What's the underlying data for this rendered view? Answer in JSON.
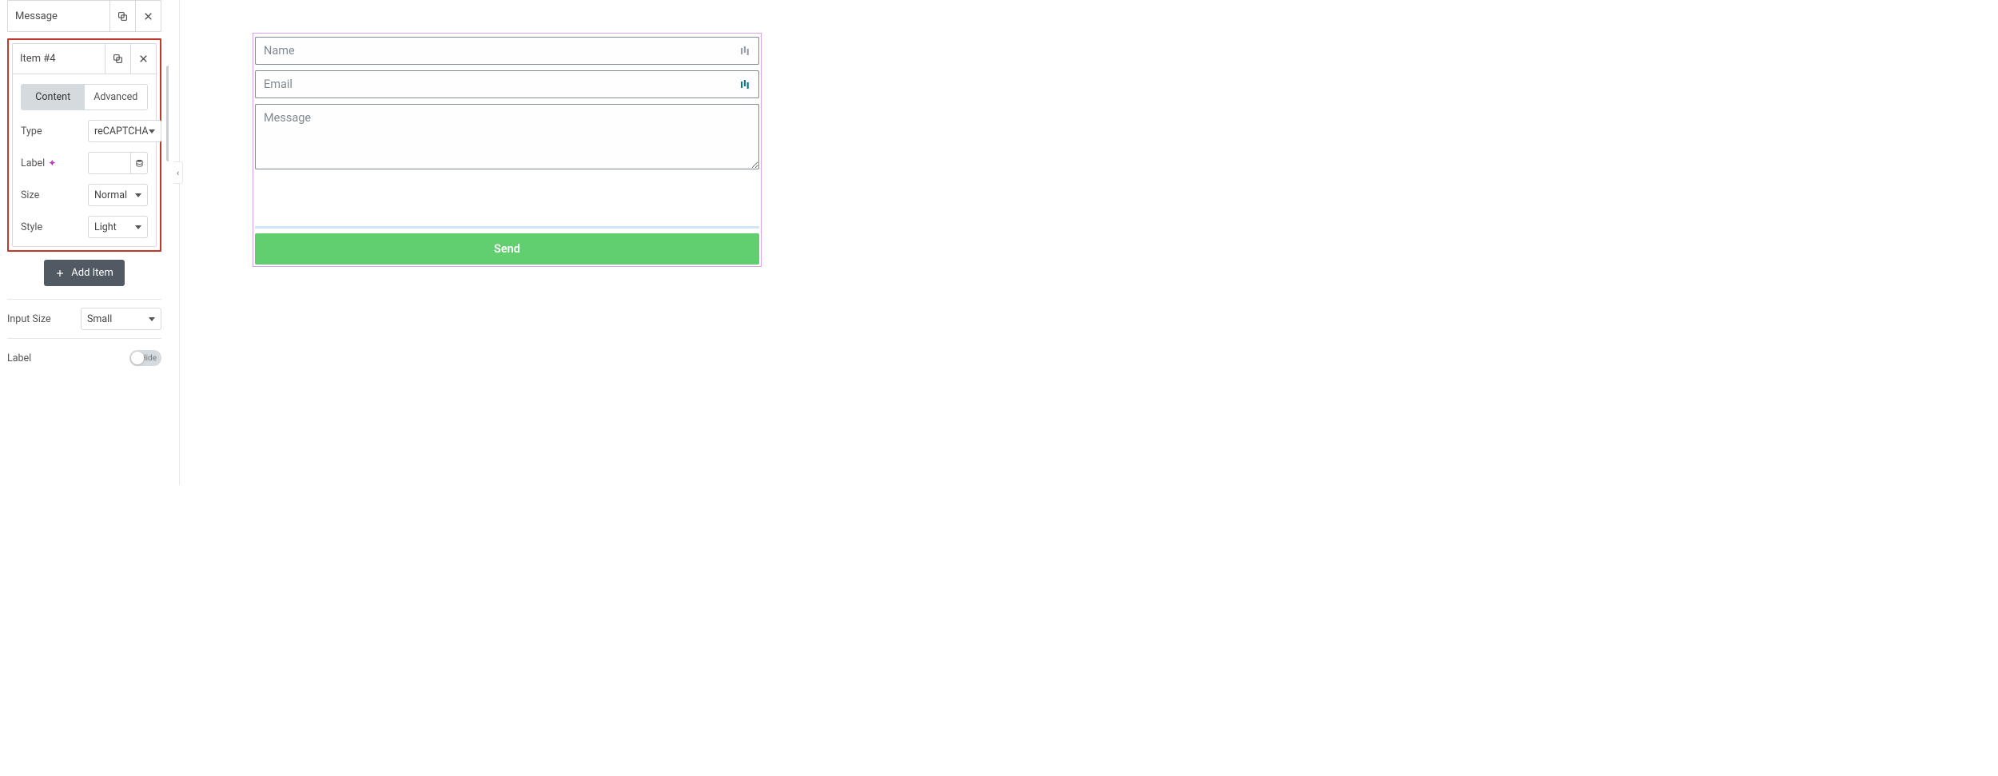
{
  "sidebar": {
    "items": [
      {
        "title": "Message"
      },
      {
        "title": "Item #4"
      }
    ],
    "highlighted_item": {
      "tabs": {
        "content": "Content",
        "advanced": "Advanced"
      },
      "type": {
        "label": "Type",
        "value": "reCAPTCHA"
      },
      "field_label": {
        "label": "Label",
        "value": ""
      },
      "size": {
        "label": "Size",
        "value": "Normal"
      },
      "style": {
        "label": "Style",
        "value": "Light"
      }
    },
    "add_item_label": "Add Item",
    "input_size": {
      "label": "Input Size",
      "value": "Small"
    },
    "label_toggle": {
      "label": "Label",
      "state": "Hide"
    }
  },
  "preview": {
    "name_placeholder": "Name",
    "email_placeholder": "Email",
    "message_placeholder": "Message",
    "send_label": "Send"
  }
}
